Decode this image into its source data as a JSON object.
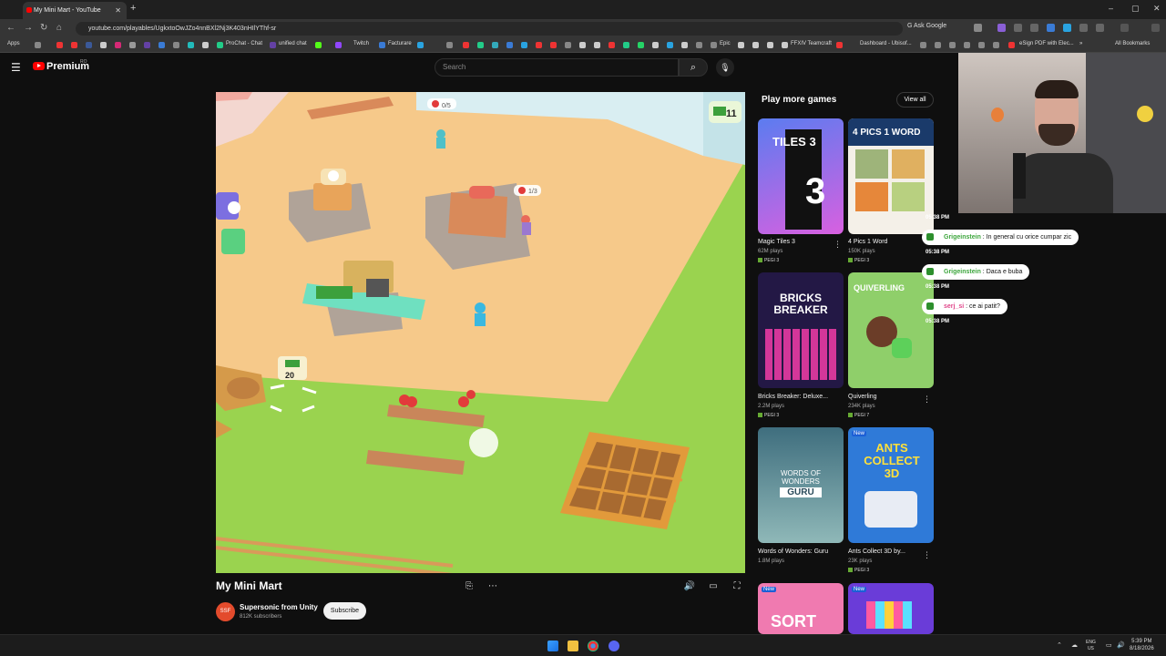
{
  "browser": {
    "tab_title": "My Mini Mart - YouTube",
    "url": "youtube.com/playables/UgkxtoOwJZo4nnBXl2Nj3K403nHIlYThf-sr",
    "ask_google": "Ask Google",
    "bookmarks": [
      "Apps",
      "ProChat - Chat",
      "unified chat",
      "Twitch",
      "Facturare",
      "Epic",
      "FFXIV Teamcraft",
      "Dashboard - Ubisof...",
      "eSign PDF with Elec...",
      "All Bookmarks"
    ]
  },
  "youtube": {
    "logo_text": "Premium",
    "logo_region": "RO",
    "search_placeholder": "Search"
  },
  "game": {
    "title": "My Mini Mart",
    "cash": "11",
    "money_stack": "20",
    "shelf_counter_1": "0/5",
    "shelf_counter_2": "1/3"
  },
  "channel": {
    "name": "Supersonic from Unity",
    "subscribers": "812K subscribers",
    "subscribe_label": "Subscribe",
    "avatar_text": "SSF"
  },
  "play_more": {
    "heading": "Play more games",
    "view_all": "View all",
    "games": [
      {
        "title": "Magic Tiles 3",
        "plays": "62M plays",
        "rating": "PEGI 3"
      },
      {
        "title": "4 Pics 1 Word",
        "plays": "150K plays",
        "rating": "PEGI 3"
      },
      {
        "title": "Bricks Breaker: Deluxe...",
        "plays": "2.2M plays",
        "rating": "PEGI 3"
      },
      {
        "title": "Quiverling",
        "plays": "234K plays",
        "rating": "PEGI 7"
      },
      {
        "title": "Words of Wonders: Guru",
        "plays": "1.8M plays",
        "rating": ""
      },
      {
        "title": "Ants Collect 3D by...",
        "plays": "23K plays",
        "rating": "PEGI 3"
      }
    ],
    "card_art": {
      "tiles3": "TILES 3",
      "four_pics": "4 PICS 1 WORD",
      "bricks": "BRICKS BREAKER",
      "quiverling": "QUIVERLING",
      "words": "WORDS OF WONDERS",
      "guru": "GURU",
      "ants": "ANTS COLLECT 3D",
      "sort": "SORT",
      "new_badge": "New"
    }
  },
  "chat": [
    {
      "time": "05:38 PM",
      "user": "Grigeinstein",
      "message": "In general cu orice cumpar zic"
    },
    {
      "time": "05:38 PM",
      "user": "Grigeinstein",
      "message": "Daca e buba"
    },
    {
      "time": "05:38 PM",
      "user": "serj_si",
      "message": "ce ai patit?"
    }
  ],
  "chat_extra_time": "05:38 PM",
  "taskbar": {
    "lang": "ENG",
    "region": "US",
    "time": "5:39 PM",
    "date": "8/18/2026"
  },
  "colors": {
    "youtube_red": "#ff0000",
    "grass": "#9ad34f",
    "floor": "#f6c98a",
    "chat_user_green": "#3da63d"
  }
}
